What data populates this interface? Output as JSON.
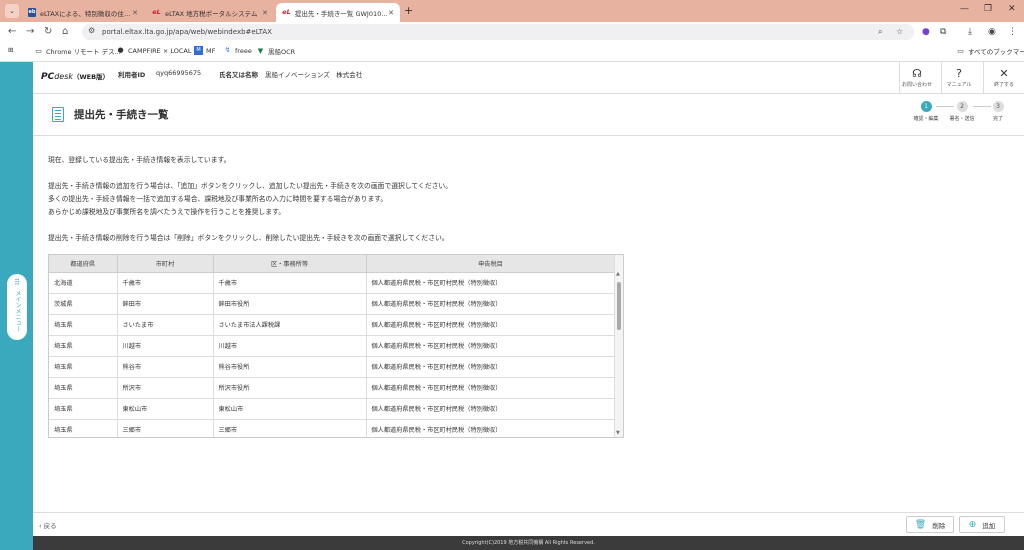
{
  "browser": {
    "tabs": [
      {
        "favicon": "eb",
        "title": "eLTAXによる、特別徴収の住民税...",
        "active": false
      },
      {
        "favicon": "eL",
        "title": "eLTAX 地方税ポータルシステム",
        "active": false
      },
      {
        "favicon": "eL",
        "title": "提出先・手続き一覧 GWJ01010",
        "active": true
      }
    ],
    "url": "portal.eltax.lta.go.jp/apa/web/webindexb#eLTAX",
    "bookmarks": [
      "Chrome リモート デス...",
      "CAMPFIRE × LOCAL",
      "MF",
      "freee",
      "黒船OCR"
    ],
    "all_bookmarks": "すべてのブックマーク"
  },
  "app": {
    "logo": {
      "pc": "PC",
      "desk": "desk",
      "web": "（WEB版）"
    },
    "user_id_label": "利用者ID",
    "user_id": "qyq66995675",
    "name_label": "氏名又は名称",
    "name": "黒船イノベーションズ　株式会社",
    "header_buttons": [
      {
        "icon": "headset-icon",
        "glyph": "☊",
        "label": "お問い合わせ"
      },
      {
        "icon": "help-icon",
        "glyph": "?",
        "label": "マニュアル"
      },
      {
        "icon": "close-icon",
        "glyph": "✕",
        "label": "終了する"
      }
    ],
    "side_menu_label": "メインメニュー",
    "page_title": "提出先・手続き一覧",
    "steps": [
      {
        "num": "1",
        "label": "確認・編集",
        "active": true
      },
      {
        "num": "2",
        "label": "署名・送信",
        "active": false
      },
      {
        "num": "3",
        "label": "完了",
        "active": false
      }
    ],
    "paragraphs": [
      "現在、登録している提出先・手続き情報を表示しています。",
      "提出先・手続き情報の追加を行う場合は、「追加」ボタンをクリックし、追加したい提出先・手続きを次の画面で選択してください。",
      "多くの提出先・手続き情報を一括で追加する場合、課税地及び事業所名の入力に時間を要する場合があります。",
      "あらかじめ課税地及び事業所名を調べたうえで操作を行うことを推奨します。",
      "提出先・手続き情報の削除を行う場合は「削除」ボタンをクリックし、削除したい提出先・手続きを次の画面で選択してください。"
    ],
    "table": {
      "headers": [
        "都道府県",
        "市町村",
        "区・事務所等",
        "申告税目"
      ],
      "rows": [
        [
          "北海道",
          "千歳市",
          "千歳市",
          "個人都道府県民税・市区町村民税（特別徴収）"
        ],
        [
          "茨城県",
          "鉾田市",
          "鉾田市役所",
          "個人都道府県民税・市区町村民税（特別徴収）"
        ],
        [
          "埼玉県",
          "さいたま市",
          "さいたま市法人課税課",
          "個人都道府県民税・市区町村民税（特別徴収）"
        ],
        [
          "埼玉県",
          "川越市",
          "川越市",
          "個人都道府県民税・市区町村民税（特別徴収）"
        ],
        [
          "埼玉県",
          "熊谷市",
          "熊谷市役所",
          "個人都道府県民税・市区町村民税（特別徴収）"
        ],
        [
          "埼玉県",
          "所沢市",
          "所沢市役所",
          "個人都道府県民税・市区町村民税（特別徴収）"
        ],
        [
          "埼玉県",
          "東松山市",
          "東松山市",
          "個人都道府県民税・市区町村民税（特別徴収）"
        ],
        [
          "埼玉県",
          "三郷市",
          "三郷市",
          "個人都道府県民税・市区町村民税（特別徴収）"
        ]
      ]
    },
    "back_label": "戻る",
    "delete_label": "削除",
    "add_label": "追加",
    "copyright": "Copyright(C)2019 地方税共同機構 All Rights Reserved."
  },
  "colors": {
    "accent": "#3aa9be",
    "tabbar": "#e8b2a0",
    "footer": "#3b3b3b"
  }
}
